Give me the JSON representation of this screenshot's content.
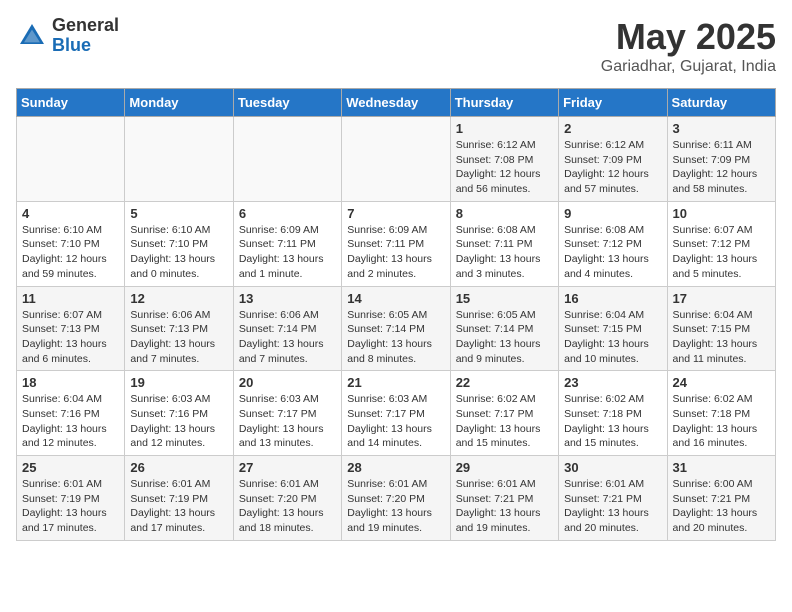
{
  "header": {
    "logo_general": "General",
    "logo_blue": "Blue",
    "month_title": "May 2025",
    "location": "Gariadhar, Gujarat, India"
  },
  "days_of_week": [
    "Sunday",
    "Monday",
    "Tuesday",
    "Wednesday",
    "Thursday",
    "Friday",
    "Saturday"
  ],
  "weeks": [
    [
      {
        "day": "",
        "info": ""
      },
      {
        "day": "",
        "info": ""
      },
      {
        "day": "",
        "info": ""
      },
      {
        "day": "",
        "info": ""
      },
      {
        "day": "1",
        "info": "Sunrise: 6:12 AM\nSunset: 7:08 PM\nDaylight: 12 hours\nand 56 minutes."
      },
      {
        "day": "2",
        "info": "Sunrise: 6:12 AM\nSunset: 7:09 PM\nDaylight: 12 hours\nand 57 minutes."
      },
      {
        "day": "3",
        "info": "Sunrise: 6:11 AM\nSunset: 7:09 PM\nDaylight: 12 hours\nand 58 minutes."
      }
    ],
    [
      {
        "day": "4",
        "info": "Sunrise: 6:10 AM\nSunset: 7:10 PM\nDaylight: 12 hours\nand 59 minutes."
      },
      {
        "day": "5",
        "info": "Sunrise: 6:10 AM\nSunset: 7:10 PM\nDaylight: 13 hours\nand 0 minutes."
      },
      {
        "day": "6",
        "info": "Sunrise: 6:09 AM\nSunset: 7:11 PM\nDaylight: 13 hours\nand 1 minute."
      },
      {
        "day": "7",
        "info": "Sunrise: 6:09 AM\nSunset: 7:11 PM\nDaylight: 13 hours\nand 2 minutes."
      },
      {
        "day": "8",
        "info": "Sunrise: 6:08 AM\nSunset: 7:11 PM\nDaylight: 13 hours\nand 3 minutes."
      },
      {
        "day": "9",
        "info": "Sunrise: 6:08 AM\nSunset: 7:12 PM\nDaylight: 13 hours\nand 4 minutes."
      },
      {
        "day": "10",
        "info": "Sunrise: 6:07 AM\nSunset: 7:12 PM\nDaylight: 13 hours\nand 5 minutes."
      }
    ],
    [
      {
        "day": "11",
        "info": "Sunrise: 6:07 AM\nSunset: 7:13 PM\nDaylight: 13 hours\nand 6 minutes."
      },
      {
        "day": "12",
        "info": "Sunrise: 6:06 AM\nSunset: 7:13 PM\nDaylight: 13 hours\nand 7 minutes."
      },
      {
        "day": "13",
        "info": "Sunrise: 6:06 AM\nSunset: 7:14 PM\nDaylight: 13 hours\nand 7 minutes."
      },
      {
        "day": "14",
        "info": "Sunrise: 6:05 AM\nSunset: 7:14 PM\nDaylight: 13 hours\nand 8 minutes."
      },
      {
        "day": "15",
        "info": "Sunrise: 6:05 AM\nSunset: 7:14 PM\nDaylight: 13 hours\nand 9 minutes."
      },
      {
        "day": "16",
        "info": "Sunrise: 6:04 AM\nSunset: 7:15 PM\nDaylight: 13 hours\nand 10 minutes."
      },
      {
        "day": "17",
        "info": "Sunrise: 6:04 AM\nSunset: 7:15 PM\nDaylight: 13 hours\nand 11 minutes."
      }
    ],
    [
      {
        "day": "18",
        "info": "Sunrise: 6:04 AM\nSunset: 7:16 PM\nDaylight: 13 hours\nand 12 minutes."
      },
      {
        "day": "19",
        "info": "Sunrise: 6:03 AM\nSunset: 7:16 PM\nDaylight: 13 hours\nand 12 minutes."
      },
      {
        "day": "20",
        "info": "Sunrise: 6:03 AM\nSunset: 7:17 PM\nDaylight: 13 hours\nand 13 minutes."
      },
      {
        "day": "21",
        "info": "Sunrise: 6:03 AM\nSunset: 7:17 PM\nDaylight: 13 hours\nand 14 minutes."
      },
      {
        "day": "22",
        "info": "Sunrise: 6:02 AM\nSunset: 7:17 PM\nDaylight: 13 hours\nand 15 minutes."
      },
      {
        "day": "23",
        "info": "Sunrise: 6:02 AM\nSunset: 7:18 PM\nDaylight: 13 hours\nand 15 minutes."
      },
      {
        "day": "24",
        "info": "Sunrise: 6:02 AM\nSunset: 7:18 PM\nDaylight: 13 hours\nand 16 minutes."
      }
    ],
    [
      {
        "day": "25",
        "info": "Sunrise: 6:01 AM\nSunset: 7:19 PM\nDaylight: 13 hours\nand 17 minutes."
      },
      {
        "day": "26",
        "info": "Sunrise: 6:01 AM\nSunset: 7:19 PM\nDaylight: 13 hours\nand 17 minutes."
      },
      {
        "day": "27",
        "info": "Sunrise: 6:01 AM\nSunset: 7:20 PM\nDaylight: 13 hours\nand 18 minutes."
      },
      {
        "day": "28",
        "info": "Sunrise: 6:01 AM\nSunset: 7:20 PM\nDaylight: 13 hours\nand 19 minutes."
      },
      {
        "day": "29",
        "info": "Sunrise: 6:01 AM\nSunset: 7:21 PM\nDaylight: 13 hours\nand 19 minutes."
      },
      {
        "day": "30",
        "info": "Sunrise: 6:01 AM\nSunset: 7:21 PM\nDaylight: 13 hours\nand 20 minutes."
      },
      {
        "day": "31",
        "info": "Sunrise: 6:00 AM\nSunset: 7:21 PM\nDaylight: 13 hours\nand 20 minutes."
      }
    ]
  ]
}
